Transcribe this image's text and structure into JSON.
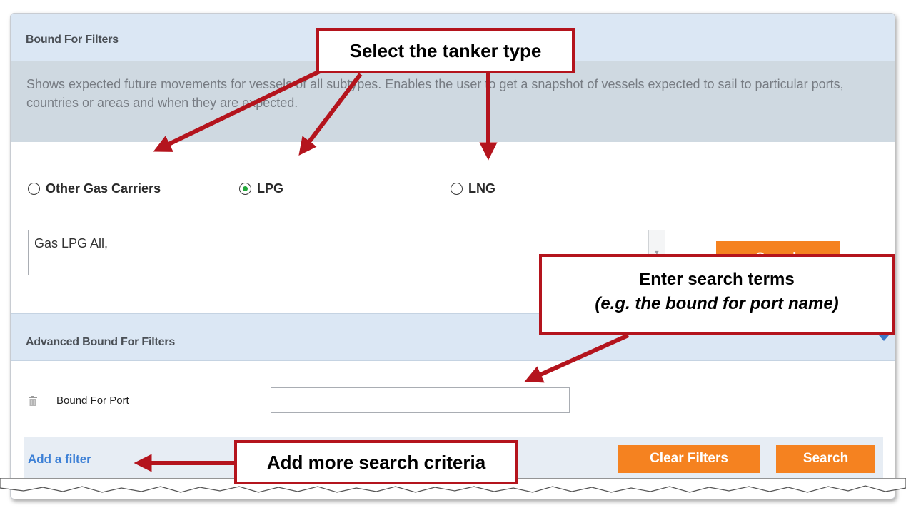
{
  "header": {
    "title": "Bound For Filters"
  },
  "description": "Shows expected future movements for vessels of all subtypes. Enables the user to get a snapshot of vessels expected to sail to particular ports, countries or areas and when they are expected.",
  "tanker_types": [
    {
      "label": "Other Gas Carriers",
      "selected": false
    },
    {
      "label": "LPG",
      "selected": true
    },
    {
      "label": "LNG",
      "selected": false
    }
  ],
  "search_combo": {
    "value": "Gas LPG All,"
  },
  "top_search_button": {
    "label": "Search"
  },
  "advanced": {
    "title": "Advanced Bound For Filters"
  },
  "filters": [
    {
      "label": "Bound For Port",
      "value": ""
    }
  ],
  "footer": {
    "add_filter": "Add a filter",
    "clear_filters": "Clear Filters",
    "search": "Search"
  },
  "callouts": {
    "tanker_type": "Select the tanker type",
    "search_terms_line1": "Enter search terms",
    "search_terms_line2": "(e.g. the bound for port name)",
    "more_criteria": "Add more search criteria"
  },
  "colors": {
    "accent_orange": "#f58220",
    "callout_red": "#b4141d",
    "link_blue": "#3d80d6",
    "header_blue": "#dbe7f4"
  }
}
